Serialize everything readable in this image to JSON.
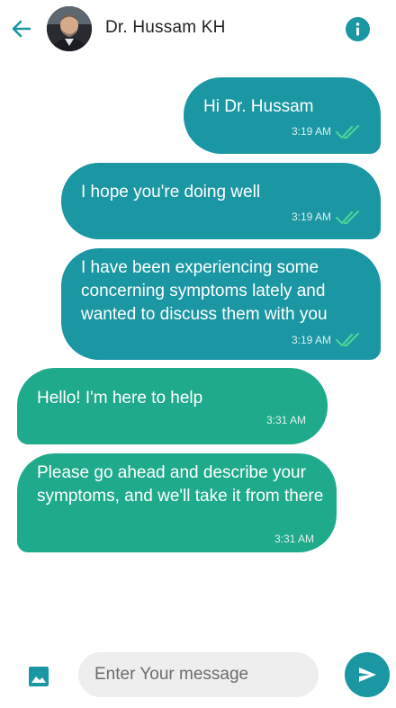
{
  "header": {
    "contact_name": "Dr. Hussam KH",
    "back_icon": "arrow-left-icon",
    "info_icon": "info-icon"
  },
  "messages": [
    {
      "direction": "outgoing",
      "text": "Hi Dr. Hussam",
      "time": "3:19 AM",
      "status": "read"
    },
    {
      "direction": "outgoing",
      "text": "I hope you're doing well",
      "time": "3:19 AM",
      "status": "read"
    },
    {
      "direction": "outgoing",
      "text": "I have been experiencing some concerning symptoms lately and wanted to discuss them with you",
      "time": "3:19 AM",
      "status": "read"
    },
    {
      "direction": "incoming",
      "text": "Hello! I'm here to help",
      "time": "3:31 AM"
    },
    {
      "direction": "incoming",
      "text": "Please go ahead and describe your symptoms, and we'll take it from there",
      "time": "3:31 AM"
    }
  ],
  "composer": {
    "placeholder": "Enter Your message",
    "value": "",
    "gallery_icon": "image-icon",
    "send_icon": "send-icon"
  },
  "colors": {
    "accent": "#1a97a3",
    "outgoing_bubble": "#1a97a3",
    "incoming_bubble": "#1eaa8b",
    "read_ticks": "#4cd39a",
    "input_bg": "#eeeeee"
  }
}
